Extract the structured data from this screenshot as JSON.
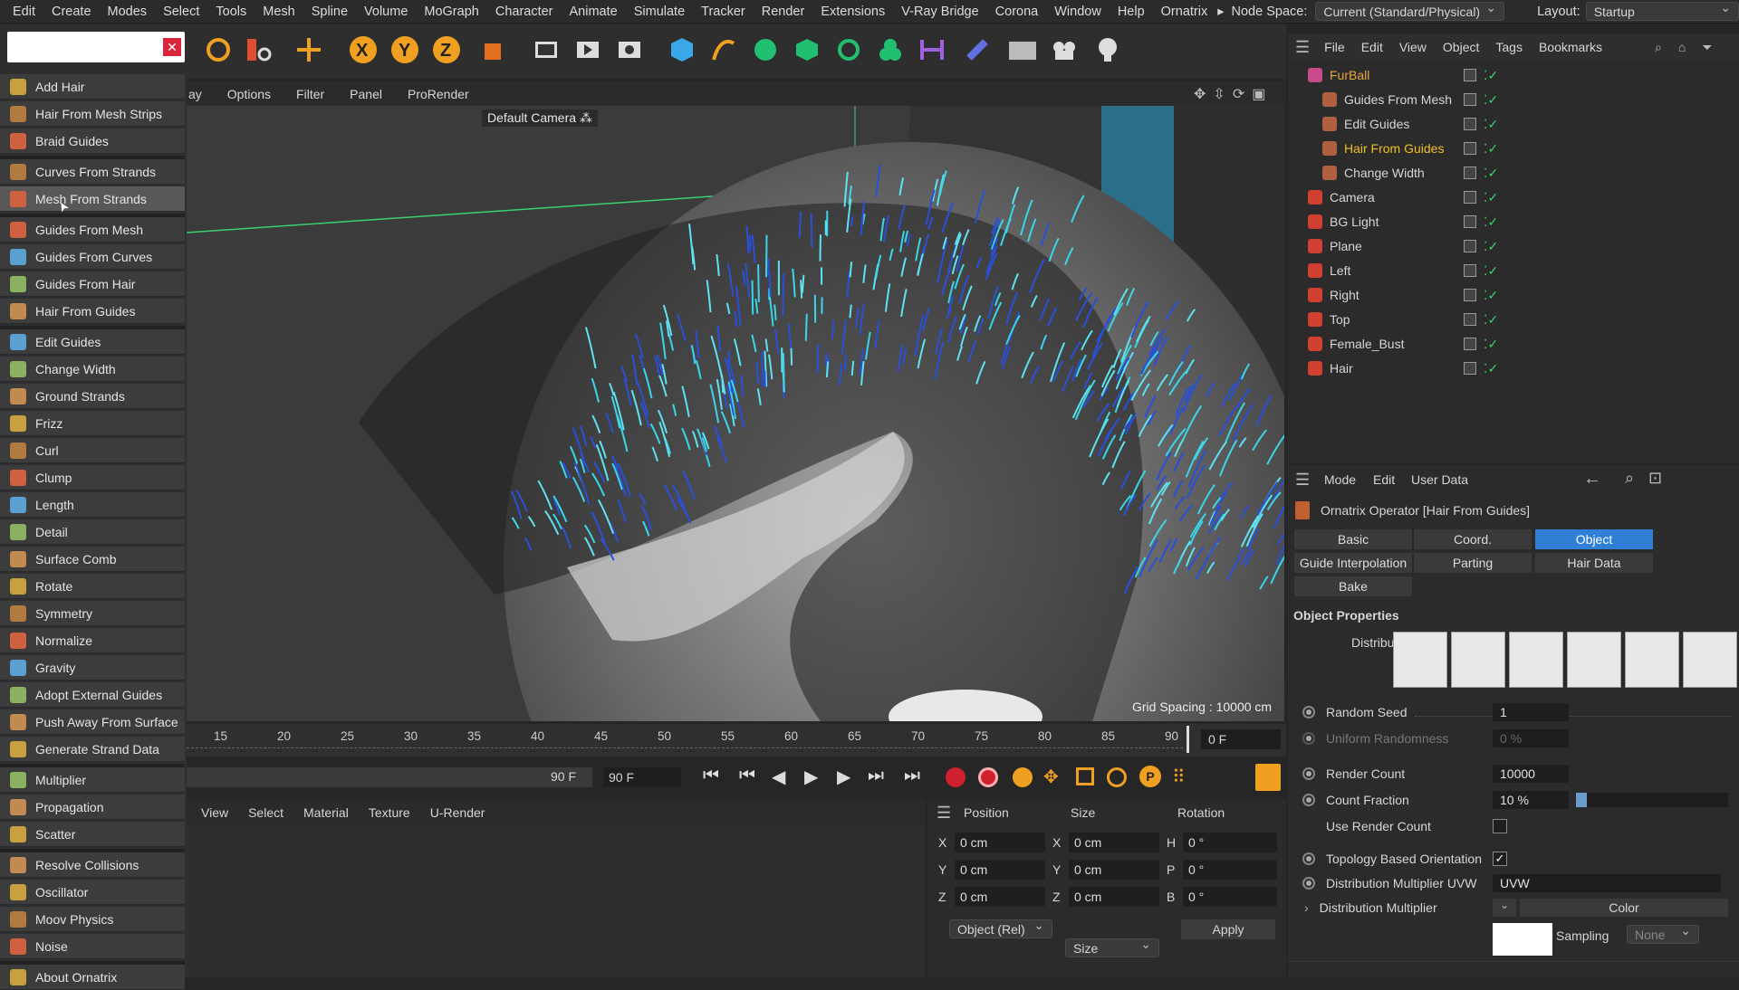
{
  "menubar": {
    "items": [
      "Edit",
      "Create",
      "Modes",
      "Select",
      "Tools",
      "Mesh",
      "Spline",
      "Volume",
      "MoGraph",
      "Character",
      "Animate",
      "Simulate",
      "Tracker",
      "Render",
      "Extensions",
      "V-Ray Bridge",
      "Corona",
      "Window",
      "Help",
      "Ornatrix"
    ],
    "node_space_label": "Node Space:",
    "node_space_value": "Current (Standard/Physical)",
    "layout_label": "Layout:",
    "layout_value": "Startup"
  },
  "ornatrix_menu": {
    "groups": [
      [
        "Add Hair",
        "Hair From Mesh Strips",
        "Braid Guides"
      ],
      [
        "Curves From Strands",
        "Mesh From Strands"
      ],
      [
        "Guides From Mesh",
        "Guides From Curves",
        "Guides From Hair",
        "Hair From Guides"
      ],
      [
        "Edit Guides",
        "Change Width",
        "Ground Strands",
        "Frizz",
        "Curl",
        "Clump",
        "Length",
        "Detail",
        "Surface Comb",
        "Rotate",
        "Symmetry",
        "Normalize",
        "Gravity",
        "Adopt External Guides",
        "Push Away From Surface",
        "Generate Strand Data"
      ],
      [
        "Multiplier",
        "Propagation",
        "Scatter"
      ],
      [
        "Resolve Collisions",
        "Oscillator",
        "Moov Physics",
        "Noise"
      ],
      [
        "About Ornatrix"
      ]
    ],
    "highlighted": "Mesh From Strands"
  },
  "viewport": {
    "menu": [
      "ay",
      "Options",
      "Filter",
      "Panel",
      "ProRender"
    ],
    "camera_label": "Default Camera",
    "grid_spacing": "Grid Spacing : 10000 cm"
  },
  "timeline": {
    "ticks": [
      "15",
      "20",
      "25",
      "30",
      "35",
      "40",
      "45",
      "50",
      "55",
      "60",
      "65",
      "70",
      "75",
      "80",
      "85",
      "90"
    ],
    "current_frame": "0 F",
    "end_frame_a": "90 F",
    "end_frame_b": "90 F"
  },
  "material_bar": [
    "View",
    "Select",
    "Material",
    "Texture",
    "U-Render"
  ],
  "coords": {
    "headers": [
      "Position",
      "Size",
      "Rotation"
    ],
    "rows": [
      {
        "axis": "X",
        "pos": "0 cm",
        "size_axis": "X",
        "size": "0 cm",
        "rot_axis": "H",
        "rot": "0 °"
      },
      {
        "axis": "Y",
        "pos": "0 cm",
        "size_axis": "Y",
        "size": "0 cm",
        "rot_axis": "P",
        "rot": "0 °"
      },
      {
        "axis": "Z",
        "pos": "0 cm",
        "size_axis": "Z",
        "size": "0 cm",
        "rot_axis": "B",
        "rot": "0 °"
      }
    ],
    "mode": "Object (Rel)",
    "size_mode": "Size",
    "apply": "Apply"
  },
  "object_manager": {
    "menu": [
      "File",
      "Edit",
      "View",
      "Object",
      "Tags",
      "Bookmarks"
    ],
    "objects": [
      {
        "name": "FurBall",
        "indent": 0,
        "color": "#e8a640"
      },
      {
        "name": "Guides From Mesh",
        "indent": 1,
        "color": "#d6d6d6"
      },
      {
        "name": "Edit Guides",
        "indent": 1,
        "color": "#d6d6d6"
      },
      {
        "name": "Hair From Guides",
        "indent": 1,
        "color": "#f0c020"
      },
      {
        "name": "Change Width",
        "indent": 1,
        "color": "#d6d6d6"
      },
      {
        "name": "Camera",
        "indent": 0,
        "color": "#d6d6d6"
      },
      {
        "name": "BG Light",
        "indent": 0,
        "color": "#d6d6d6"
      },
      {
        "name": "Plane",
        "indent": 0,
        "color": "#d6d6d6"
      },
      {
        "name": "Left",
        "indent": 0,
        "color": "#d6d6d6"
      },
      {
        "name": "Right",
        "indent": 0,
        "color": "#d6d6d6"
      },
      {
        "name": "Top",
        "indent": 0,
        "color": "#d6d6d6"
      },
      {
        "name": "Female_Bust",
        "indent": 0,
        "color": "#d6d6d6"
      },
      {
        "name": "Hair",
        "indent": 0,
        "color": "#d6d6d6"
      }
    ]
  },
  "attribute_manager": {
    "menu": [
      "Mode",
      "Edit",
      "User Data"
    ],
    "title": "Ornatrix Operator [Hair From Guides]",
    "tabs": [
      "Basic",
      "Coord.",
      "Object",
      "Guide Interpolation",
      "Parting",
      "Hair Data",
      "Bake"
    ],
    "active_tab": "Object",
    "section": "Object Properties",
    "distribution_label": "Distribution",
    "params": {
      "random_seed": {
        "label": "Random Seed",
        "value": "1"
      },
      "uniform_randomness": {
        "label": "Uniform Randomness",
        "value": "0 %"
      },
      "render_count": {
        "label": "Render Count",
        "value": "10000"
      },
      "count_fraction": {
        "label": "Count Fraction",
        "value": "10 %"
      },
      "use_render_count": {
        "label": "Use Render Count"
      },
      "topology": {
        "label": "Topology Based Orientation"
      },
      "dist_mult_uvw": {
        "label": "Distribution Multiplier UVW",
        "value": "UVW"
      },
      "dist_mult": {
        "label": "Distribution Multiplier",
        "value": "Color"
      },
      "sampling": {
        "label": "Sampling",
        "value": "None"
      }
    }
  }
}
